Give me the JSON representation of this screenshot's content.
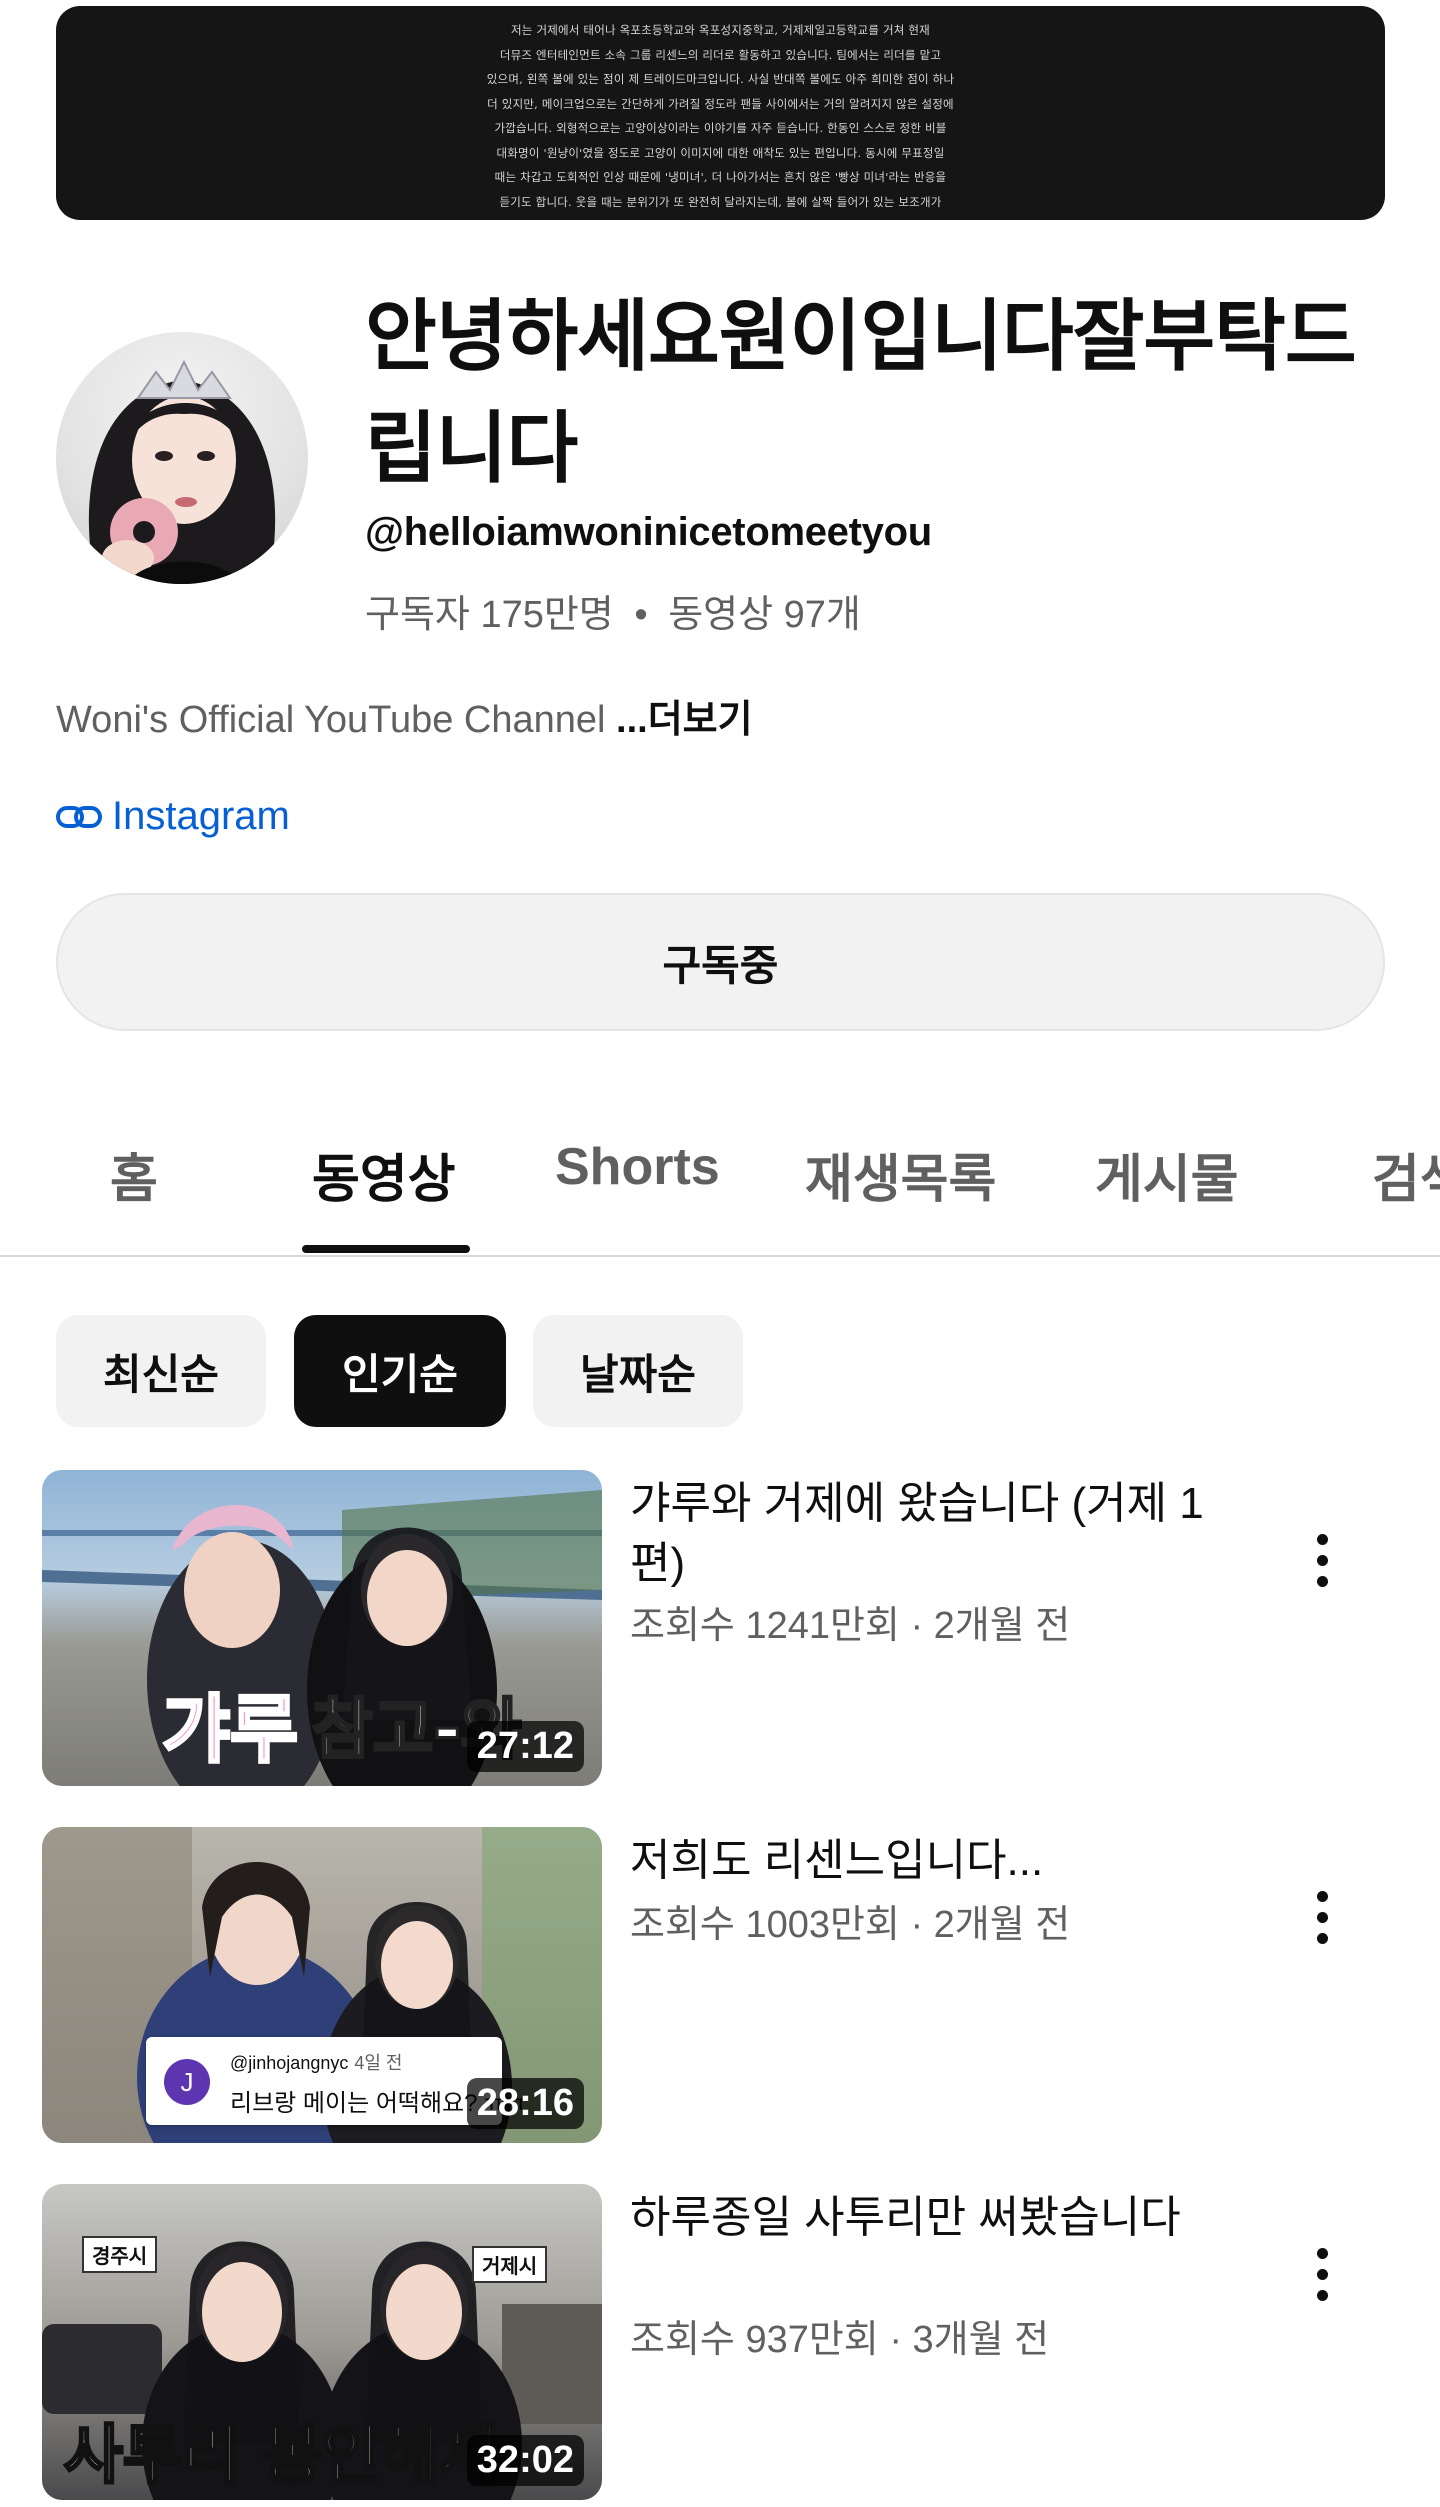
{
  "banner": {
    "text": "저는 거제에서 태어나 옥포초등학교와 옥포성지중학교, 거제제일고등학교를 거쳐 현재\n더뮤즈 엔터테인먼트 소속 그룹 리센느의 리더로 활동하고 있습니다. 팀에서는 리더를 맡고\n있으며, 왼쪽 볼에 있는 점이 제 트레이드마크입니다. 사실 반대쪽 볼에도 아주 희미한 점이 하나\n더 있지만, 메이크업으로는 간단하게 가려질 정도라 팬들 사이에서는 거의 알려지지 않은 설정에\n가깝습니다. 외형적으로는 고양이상이라는 이야기를 자주 듣습니다. 한동인 스스로 정한 비블\n대화명이 '원냥이'였을 정도로 고양이 이미지에 대한 애착도 있는 편입니다. 동시에 무표정일\n때는 차갑고 도회적인 인상 때문에 '냉미녀', 더 나아가서는 흔치 않은 '빵상 미녀'라는 반응을\n듣기도 합니다. 웃을 때는 분위기가 또 완전히 달라지는데, 볼에 살짝 들어가 있는 보조개가"
  },
  "channel": {
    "title": "안녕하세요원이입니다잘부탁드립니다",
    "handle": "@helloiamwoninicetomeetyou",
    "subscribers": "구독자 175만명",
    "separator": "•",
    "video_count": "동영상 97개",
    "description": "Woni's Official YouTube Channel ",
    "more": "...더보기",
    "link_label": "Instagram",
    "subscribe_label": "구독중"
  },
  "tabs": [
    "홈",
    "동영상",
    "Shorts",
    "재생목록",
    "게시물",
    "검색"
  ],
  "chips": [
    "최신순",
    "인기순",
    "날짜순"
  ],
  "videos": [
    {
      "title": "갸루와 거제에 왔습니다 (거제 1편)",
      "meta": "조회수 1241만회 · 2개월 전",
      "duration": "27:12",
      "overlay_left": "갸루",
      "overlay_right": "참고-와"
    },
    {
      "title": "저희도 리센느입니다...",
      "meta": "조회수 1003만회 · 2개월 전",
      "duration": "28:16",
      "comment_user": "@jinhojangnyc",
      "comment_time": "4일 전",
      "comment_text": "리브랑 메이는 어떡해요? ㅠㅠ",
      "comment_initial": "J"
    },
    {
      "title": "하루종일 사투리만 써봤습니다",
      "meta": "조회수 937만회 · 3개월 전",
      "duration": "32:02",
      "overlay_text": "사투리 봉인해제",
      "sign_left": "경주시",
      "sign_right": "거제시"
    }
  ],
  "colors": {
    "link": "#065fd4",
    "secondary_text": "#606060",
    "chip_selected": "#0f0f0f",
    "chip_default": "#f2f2f2"
  }
}
